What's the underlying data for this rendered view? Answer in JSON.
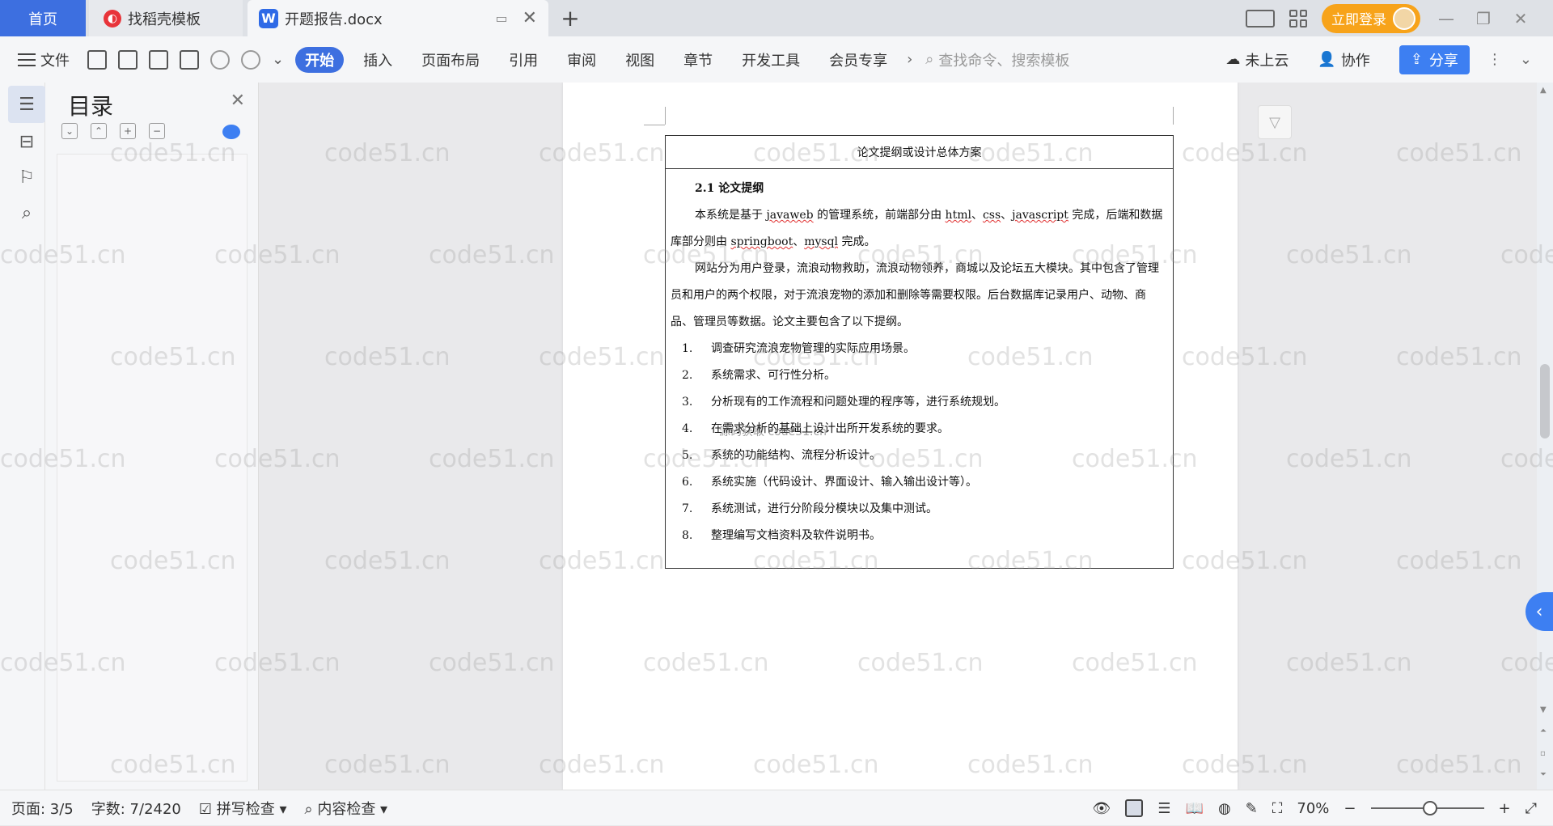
{
  "tabs": {
    "home": "首页",
    "templates": "找稻壳模板",
    "document": "开题报告.docx"
  },
  "titlebar": {
    "login": "立即登录"
  },
  "toolbar": {
    "file": "文件",
    "menus": [
      "开始",
      "插入",
      "页面布局",
      "引用",
      "审阅",
      "视图",
      "章节",
      "开发工具",
      "会员专享"
    ],
    "search_placeholder": "查找命令、搜索模板",
    "cloud": "未上云",
    "collab": "协作",
    "share": "分享"
  },
  "toc": {
    "title": "目录"
  },
  "document": {
    "table_header": "论文提纲或设计总体方案",
    "heading": "2.1 论文提纲",
    "para1_a": "本系统是基于 ",
    "para1_b": "javaweb",
    "para1_c": " 的管理系统，前端部分由 ",
    "para1_d": "html",
    "para1_e": "、",
    "para1_f": "css",
    "para1_g": "、",
    "para1_h": "javascript",
    "para1_i": " 完成，后端和数据库部分则由 ",
    "para1_j": "springboot",
    "para1_k": "、",
    "para1_l": "mysql",
    "para1_m": " 完成。",
    "para2": "网站分为用户登录，流浪动物救助，流浪动物领养，商城以及论坛五大模块。其中包含了管理员和用户的两个权限，对于流浪宠物的添加和删除等需要权限。后台数据库记录用户、动物、商品、管理员等数据。论文主要包含了以下提纲。",
    "items": [
      {
        "n": "1.",
        "t": "调查研究流浪宠物管理的实际应用场景。"
      },
      {
        "n": "2.",
        "t": "系统需求、可行性分析。"
      },
      {
        "n": "3.",
        "t": "分析现有的工作流程和问题处理的程序等，进行系统规划。"
      },
      {
        "n": "4.",
        "t": "在需求分析的基础上设计出所开发系统的要求。"
      },
      {
        "n": "5.",
        "t": "系统的功能结构、流程分析设计。"
      },
      {
        "n": "6.",
        "t": "系统实施（代码设计、界面设计、输入输出设计等）。"
      },
      {
        "n": "7.",
        "t": "系统测试，进行分阶段分模块以及集中测试。"
      },
      {
        "n": "8.",
        "t": "整理编写文档资料及软件说明书。"
      }
    ],
    "watermark_center": "源码获取 code51.cn"
  },
  "watermark": "code51.cn",
  "status": {
    "page": "页面: 3/5",
    "words": "字数: 7/2420",
    "spell": "拼写检查",
    "content": "内容检查",
    "zoom": "70%"
  },
  "colors": {
    "accent": "#3d6fe0",
    "login": "#f7a31a"
  }
}
